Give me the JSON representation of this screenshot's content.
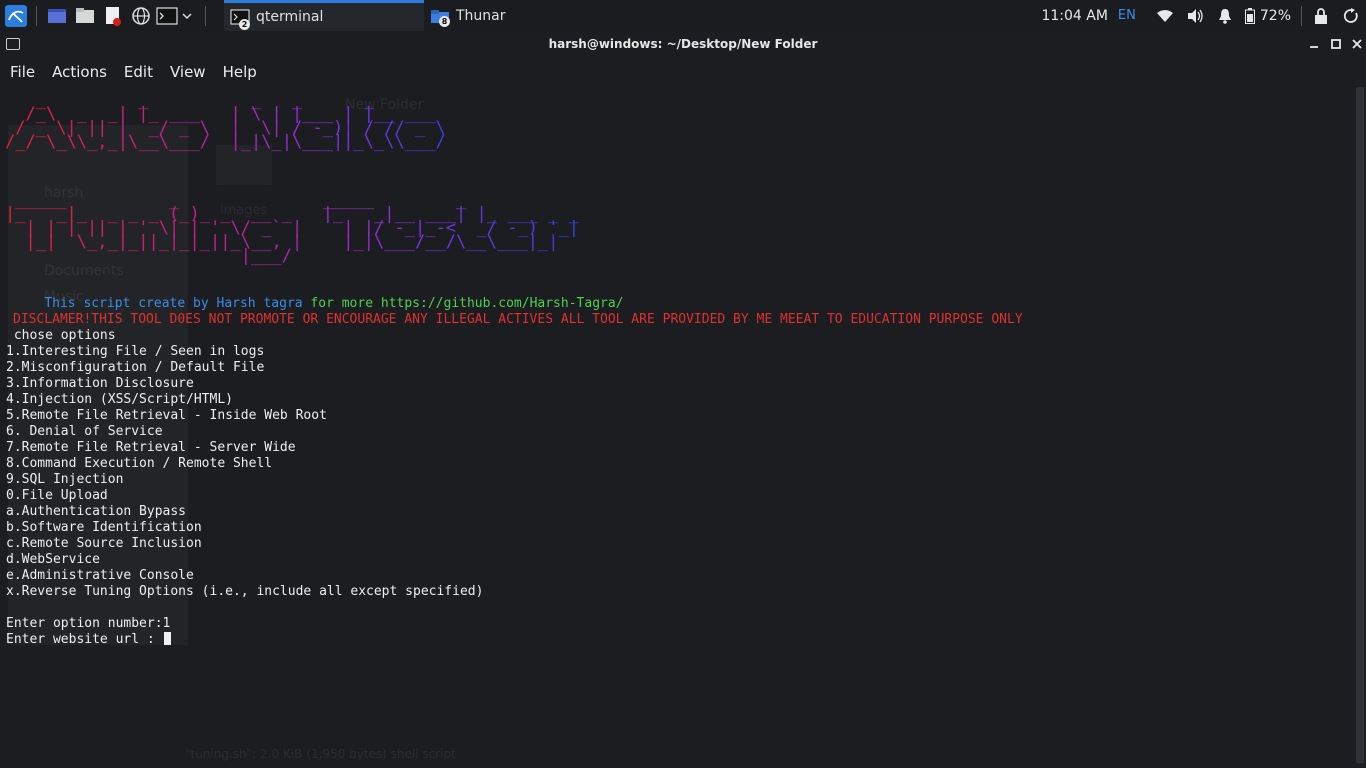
{
  "panel": {
    "tasks": [
      {
        "label": "qterminal",
        "count": "2"
      },
      {
        "label": "Thunar",
        "count": "8"
      }
    ],
    "clock": "11:04 AM",
    "lang": "EN",
    "battery": "72%"
  },
  "window": {
    "title": "harsh@windows: ~/Desktop/New Folder"
  },
  "menu": [
    "File",
    "Actions",
    "Edit",
    "View",
    "Help"
  ],
  "banner": {
    "line1": "   _         _          _   _      _          \n  /_\\  _  _| |_ ___   | \\ | |___ | |__ ___   \n / _ \\| || |  _/ _ \\  |  \\| / -_)| / // _ \\  \n/_/ \\_\\\\_,_|\\__\\___/  |_|\\_|\\___||_\\_\\\\___/  ",
    "line2": " _____          _              _____        _           \n|_   _|_  _ _ _ (_)_ _  __ _   |_   _|__ ___| |_ ___ _ _ \n  | | | || | ' \\| | ' \\/ _` |    | |/ -_|_-<  _/ -_) '_|\n  |_|  \\_,_|_||_|_|_||_\\__, |    |_|\\___/__/\\__\\___|_|  \n                       |___/                            "
  },
  "credit": {
    "prefix": "This script create by ",
    "author": "Harsh tagra",
    "middle": " for more ",
    "url": "https://github.com/Harsh-Tagra/"
  },
  "disclaimer": "DISCLAMER!THIS TOOL D0ES NOT PROMOTE OR ENCOURAGE ANY ILLEGAL ACTIVES ALL TOOL ARE PROVIDED BY ME MEEAT TO EDUCATION PURPOSE ONLY",
  "prompt_header": " chose options",
  "options": [
    "1.Interesting File / Seen in logs",
    "2.Misconfiguration / Default File",
    "3.Information Disclosure",
    "4.Injection (XSS/Script/HTML)",
    "5.Remote File Retrieval - Inside Web Root",
    "6. Denial of Service",
    "7.Remote File Retrieval - Server Wide",
    "8.Command Execution / Remote Shell",
    "9.SQL Injection",
    "0.File Upload",
    "a.Authentication Bypass",
    "b.Software Identification",
    "c.Remote Source Inclusion",
    "d.WebService",
    "e.Administrative Console",
    "x.Reverse Tuning Options (i.e., include all except specified)"
  ],
  "input_option": "Enter option number:1",
  "input_url": "Enter website url : ",
  "background_window": {
    "items": [
      "harsh",
      "Documents",
      "Music",
      "images",
      "New Folder"
    ],
    "status": "\"tuning.sh\": 2.0 KiB (1,950 bytes) shell script"
  },
  "colors": {
    "banner_gradient": [
      "#e0203a",
      "#c0208a",
      "#8a30d8",
      "#3040e0"
    ],
    "credit_blue": "#3b8de8",
    "credit_green": "#4fd04f",
    "disclaimer_red": "#e03030",
    "accent": "#2b7de0"
  }
}
